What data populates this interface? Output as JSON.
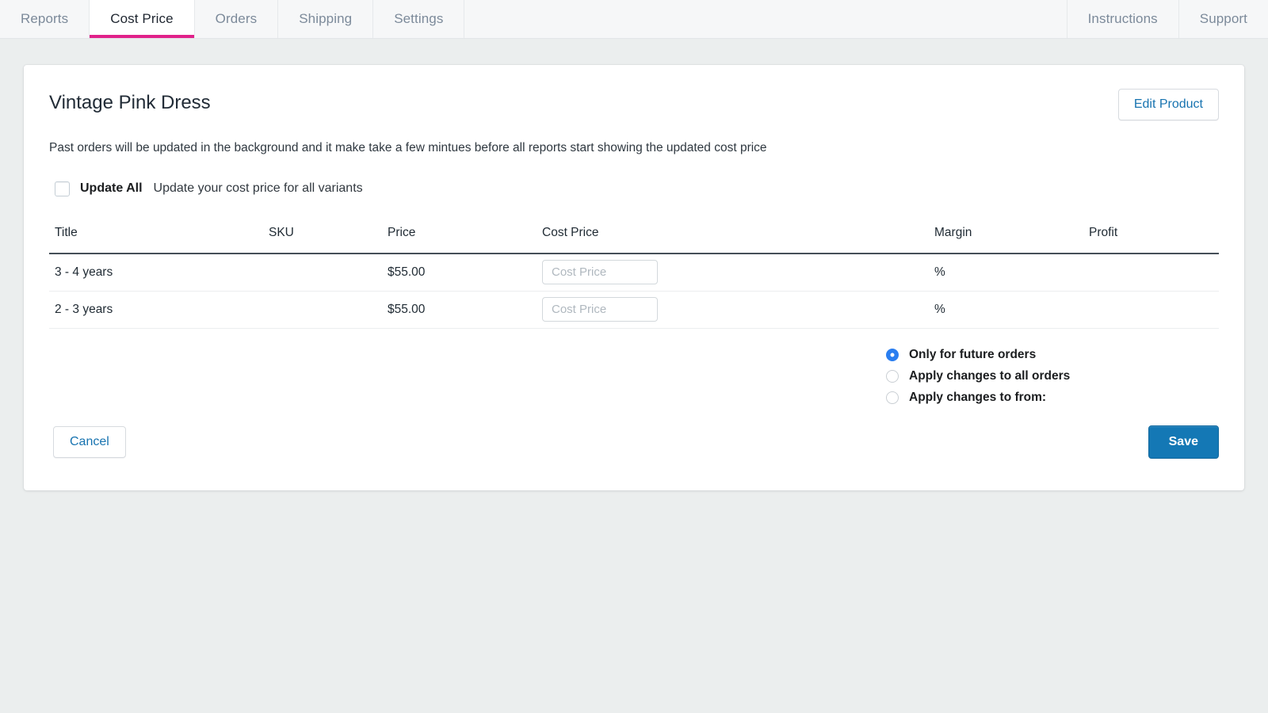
{
  "nav": {
    "left_tabs": [
      {
        "label": "Reports",
        "active": false
      },
      {
        "label": "Cost Price",
        "active": true
      },
      {
        "label": "Orders",
        "active": false
      },
      {
        "label": "Shipping",
        "active": false
      },
      {
        "label": "Settings",
        "active": false
      }
    ],
    "right_tabs": [
      {
        "label": "Instructions"
      },
      {
        "label": "Support"
      }
    ],
    "active_accent_color": "#e0218a"
  },
  "card": {
    "product_title": "Vintage Pink Dress",
    "edit_product_label": "Edit Product",
    "description": "Past orders will be updated in the background and it make take a few mintues before all reports start showing the updated cost price",
    "update_all": {
      "label": "Update All",
      "description": "Update your cost price for all variants",
      "checked": false
    },
    "table": {
      "headers": [
        "Title",
        "SKU",
        "Price",
        "Cost Price",
        "Margin",
        "Profit"
      ],
      "rows": [
        {
          "title": "3 - 4 years",
          "sku": "",
          "price": "$55.00",
          "cost_price_value": "",
          "cost_price_placeholder": "Cost Price",
          "margin": "%",
          "profit": ""
        },
        {
          "title": "2 - 3 years",
          "sku": "",
          "price": "$55.00",
          "cost_price_value": "",
          "cost_price_placeholder": "Cost Price",
          "margin": "%",
          "profit": ""
        }
      ]
    },
    "apply_options": [
      {
        "label": "Only for future orders",
        "selected": true
      },
      {
        "label": "Apply changes to all orders",
        "selected": false
      },
      {
        "label": "Apply changes to from:",
        "selected": false
      }
    ],
    "cancel_label": "Cancel",
    "save_label": "Save",
    "primary_button_color": "#1478b5",
    "link_color": "#1773b0"
  }
}
